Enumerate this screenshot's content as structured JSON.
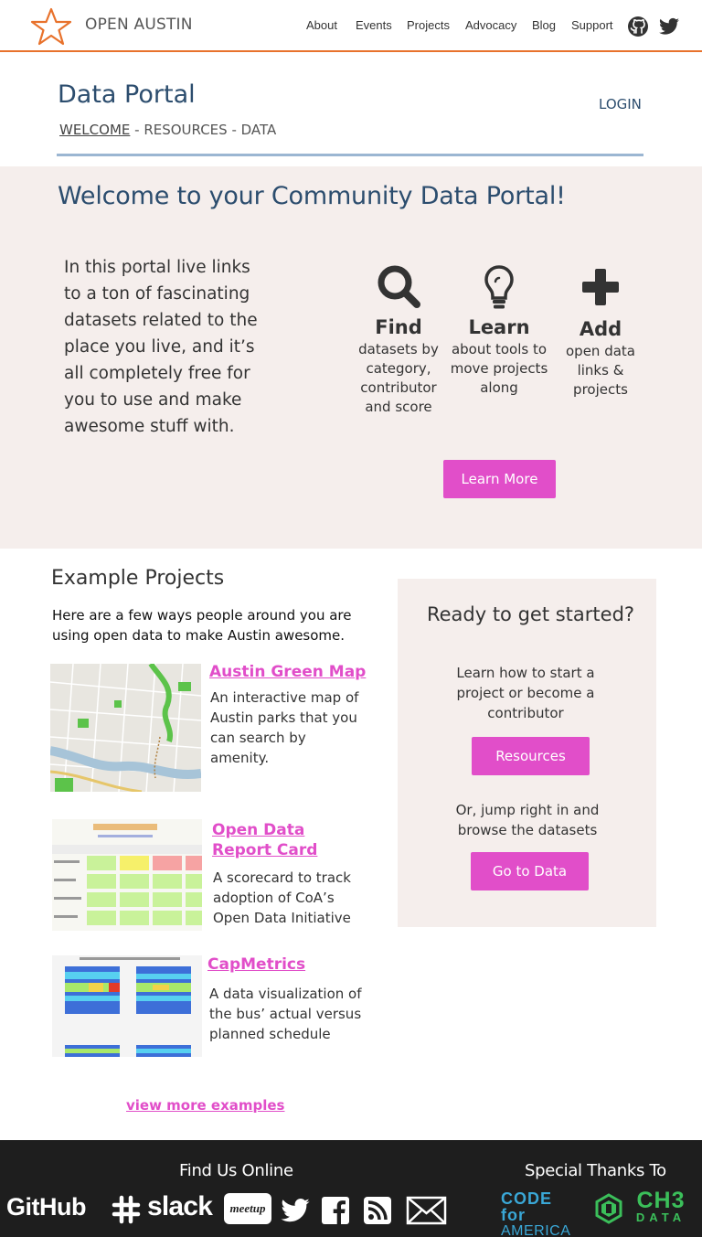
{
  "header": {
    "brand": "OPEN AUSTIN",
    "nav": [
      "About",
      "Events",
      "Projects",
      "Advocacy",
      "Blog",
      "Support"
    ],
    "icons": [
      "github-icon",
      "twitter-icon"
    ],
    "accent_color": "#e8722c"
  },
  "portal": {
    "title": "Data Portal",
    "login": "LOGIN",
    "breadcrumb": {
      "welcome": "WELCOME",
      "separator": " - ",
      "resources": "RESOURCES",
      "data": "DATA"
    }
  },
  "welcome": {
    "title": "Welcome to your Community Data Portal!",
    "intro": "In this portal live links to a ton of fascinating datasets related to the place you live, and it’s all completely free for you to use and make awesome stuff with.",
    "features": [
      {
        "icon": "search-icon",
        "title": "Find",
        "desc": "datasets by category, contributor and score"
      },
      {
        "icon": "lightbulb-icon",
        "title": "Learn",
        "desc": "about tools to move projects along"
      },
      {
        "icon": "plus-icon",
        "title": "Add",
        "desc": "open data links & projects"
      }
    ],
    "learn_more": "Learn More"
  },
  "examples": {
    "title": "Example Projects",
    "intro": "Here are a few ways people around you are using open data to make Austin awesome.",
    "projects": [
      {
        "title": "Austin Green Map",
        "desc": "An interactive map of Austin parks that you can search by amenity."
      },
      {
        "title": "Open Data Report Card",
        "desc": "A scorecard to track adoption of CoA’s Open Data Initiative"
      },
      {
        "title": "CapMetrics",
        "desc": "A data visualization of the bus’ actual versus planned schedule"
      }
    ],
    "view_more": "view more examples"
  },
  "ready": {
    "title": "Ready to get started?",
    "text1": "Learn how to start a project or become a contributor",
    "button1": "Resources",
    "text2": "Or, jump right in and browse the datasets",
    "button2": "Go to Data"
  },
  "footer": {
    "find_us": "Find Us Online",
    "thanks": "Special Thanks To",
    "github": "GitHub",
    "slack": "slack",
    "meetup": "meetup",
    "cfa_line1": "CODE for",
    "cfa_line2": "AMERICA",
    "ch3_line1": "CH3",
    "ch3_line2": "DATA"
  },
  "colors": {
    "primary_text": "#2c4d6e",
    "pink": "#e14ec9",
    "band_bg": "#f5eeec",
    "footer_bg": "#1e1e1e"
  }
}
